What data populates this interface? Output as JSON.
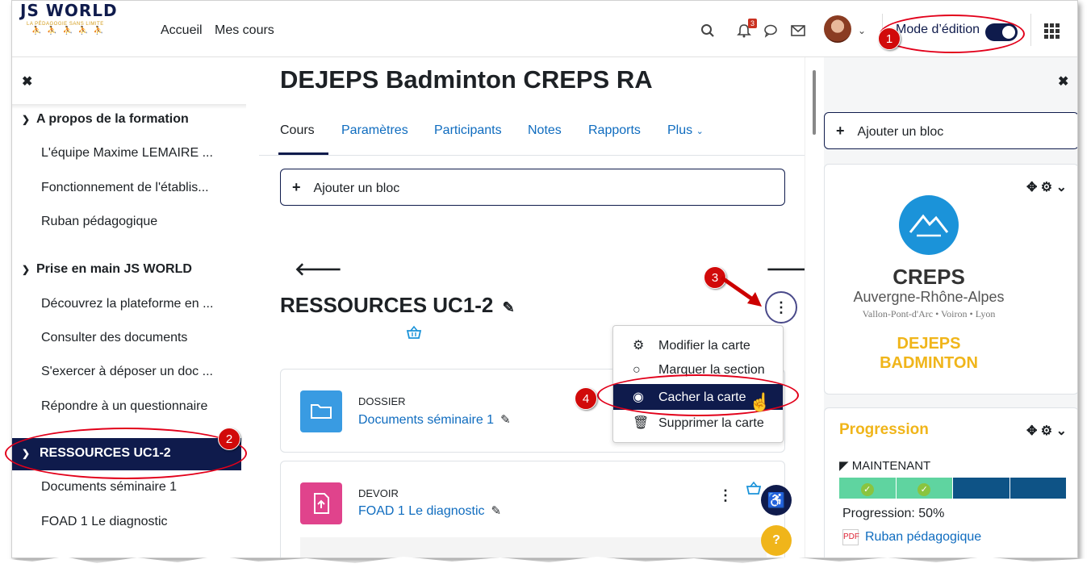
{
  "topbar": {
    "logo_line1": "JS WORLD",
    "logo_line2": "LA PÉDAGOGIE SANS LIMITE",
    "nav": [
      "Accueil",
      "Mes cours"
    ],
    "notification_count": "3",
    "edit_mode_label": "Mode d’édition"
  },
  "left_drawer": {
    "sections": [
      {
        "title": "A propos de la formation",
        "items": [
          "L'équipe Maxime LEMAIRE ...",
          "Fonctionnement de l'établis...",
          "Ruban pédagogique"
        ]
      },
      {
        "title": "Prise en main JS WORLD",
        "items": [
          "Découvrez la plateforme en ...",
          "Consulter des documents",
          "S'exercer à déposer un doc ...",
          "Répondre à un questionnaire"
        ]
      }
    ],
    "active_section": "RESSOURCES UC1-2",
    "active_items": [
      "Documents séminaire 1",
      "FOAD 1 Le diagnostic"
    ]
  },
  "main": {
    "page_title": "DEJEPS Badminton CREPS RA",
    "tabs": [
      "Cours",
      "Paramètres",
      "Participants",
      "Notes",
      "Rapports",
      "Plus"
    ],
    "add_block": "Ajouter un bloc",
    "section_title": "RESSOURCES UC1-2",
    "activities": [
      {
        "type": "DOSSIER",
        "name": "Documents séminaire 1",
        "color": "#399be2"
      },
      {
        "type": "DEVOIR",
        "name": "FOAD 1 Le diagnostic",
        "color": "#e0438c"
      }
    ]
  },
  "dropdown": {
    "items": [
      {
        "icon": "gear-icon",
        "label": "Modifier la carte"
      },
      {
        "icon": "circle-icon",
        "label": "Marquer la section"
      },
      {
        "icon": "eye-icon",
        "label": "Cacher la carte"
      },
      {
        "icon": "trash-icon",
        "label": "Supprimer la carte"
      }
    ]
  },
  "right_drawer": {
    "add_block": "Ajouter un bloc",
    "creps": {
      "name": "CREPS",
      "region": "Auvergne-Rhône-Alpes",
      "cities": "Vallon-Pont-d'Arc • Voiron • Lyon",
      "program_line1": "DEJEPS",
      "program_line2": "BADMINTON"
    },
    "progression": {
      "title": "Progression",
      "now_label": "MAINTENANT",
      "segments": [
        {
          "state": "done",
          "color": "#5fd4a0"
        },
        {
          "state": "done",
          "color": "#5fd4a0"
        },
        {
          "state": "todo",
          "color": "#0e5386"
        },
        {
          "state": "todo",
          "color": "#0e5386"
        }
      ],
      "percent_label": "Progression: 50%",
      "link": "Ruban pédagogique"
    }
  },
  "annotations": [
    "1",
    "2",
    "3",
    "4"
  ],
  "colors": {
    "primary": "#0f1b4c",
    "link": "#0f6cbf",
    "accent": "#f0b51a",
    "annotation": "#e2001a"
  }
}
